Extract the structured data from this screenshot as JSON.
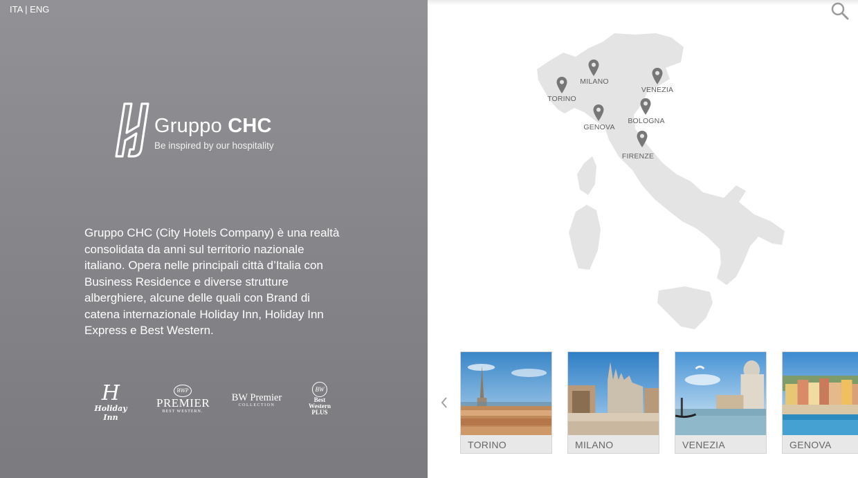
{
  "language": {
    "ita": "ITA",
    "separator": " | ",
    "eng": "ENG"
  },
  "logo": {
    "name_light": "Gruppo ",
    "name_bold": "CHC",
    "tagline": "Be inspired by our hospitality"
  },
  "intro_text": "Gruppo CHC (City Hotels Company) è una realtà consolidata da anni sul territorio nazionale italiano. Opera nelle principali città d’Italia con Business Residence e diverse strutture alberghiere, alcune delle quali con Brand di catena internazionale Holiday Inn, Holiday Inn Express e Best Western.",
  "brands": {
    "holiday_inn": {
      "mark": "H",
      "text": "Holiday Inn"
    },
    "premier": {
      "badge": "BWP",
      "big": "PREMIER",
      "small": "BEST WESTERN."
    },
    "bw_premier_collection": {
      "big": "BW Premier",
      "small": "COLLECTION"
    },
    "best_western_plus": {
      "badge": "BW",
      "line1": "Best",
      "line2": "Western",
      "line3": "PLUS"
    }
  },
  "search_icon": "search-icon",
  "map": {
    "cities": [
      "TORINO",
      "MILANO",
      "VENEZIA",
      "GENOVA",
      "BOLOGNA",
      "FIRENZE"
    ]
  },
  "carousel": {
    "prev_icon": "chevron-left-icon",
    "cards": [
      {
        "label": "TORINO"
      },
      {
        "label": "MILANO"
      },
      {
        "label": "VENEZIA"
      },
      {
        "label": "GENOVA"
      }
    ]
  },
  "colors": {
    "left_panel": "#88888c",
    "map_fill": "#e4e4e4",
    "pin": "#777777",
    "card_bg": "#e8e8e8"
  }
}
